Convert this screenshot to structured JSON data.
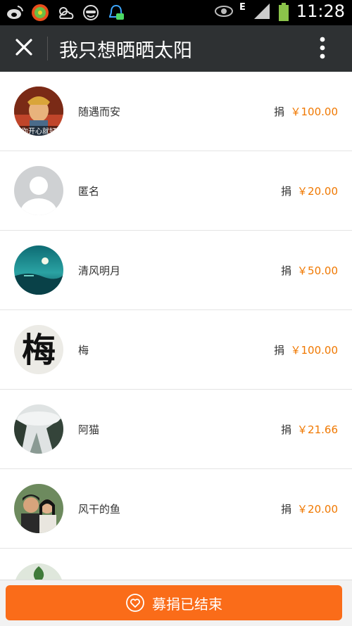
{
  "status_bar": {
    "time": "11:28",
    "network": "E",
    "icons": [
      "weibo-icon",
      "game-icon",
      "weather-icon",
      "mask-icon",
      "qq-chat-icon",
      "eye-icon",
      "signal-icon",
      "battery-icon"
    ]
  },
  "app_bar": {
    "title": "我只想晒晒太阳",
    "close_icon": "close-icon",
    "more_icon": "more-vertical-icon"
  },
  "donation_verb": "捐",
  "donors": [
    {
      "name": "随遇而安",
      "amount": "￥100.00",
      "avatar_caption": "你开心就好"
    },
    {
      "name": "匿名",
      "amount": "￥20.00"
    },
    {
      "name": "清风明月",
      "amount": "￥50.00"
    },
    {
      "name": "梅",
      "amount": "￥100.00",
      "avatar_glyph": "梅"
    },
    {
      "name": "阿猫",
      "amount": "￥21.66"
    },
    {
      "name": "风干的鱼",
      "amount": "￥20.00"
    }
  ],
  "bottom_button": {
    "label": "募捐已结束",
    "icon": "heart-icon"
  },
  "colors": {
    "amount": "#f07800",
    "button": "#fa6c19",
    "appbar": "#2e3133"
  }
}
